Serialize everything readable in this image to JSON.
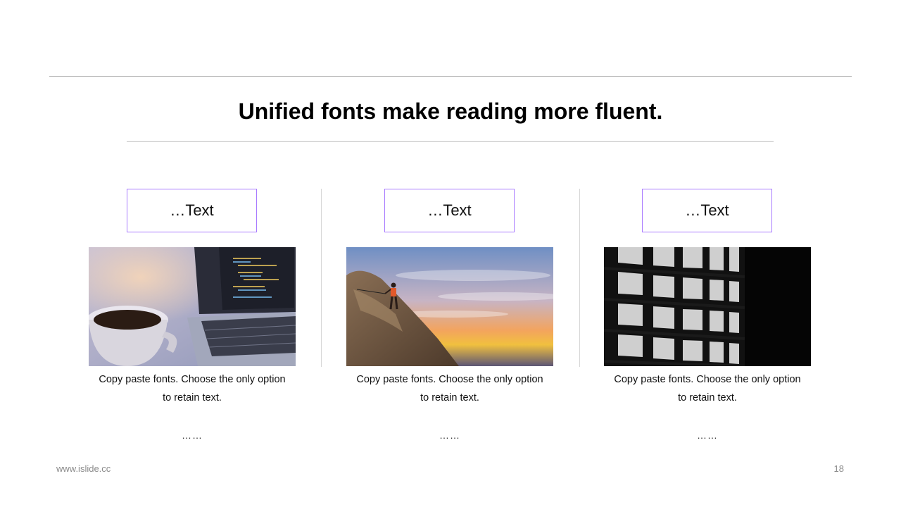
{
  "title": "Unified fonts make reading more fluent.",
  "columns": [
    {
      "label": "…Text",
      "image": "laptop-and-coffee-photo",
      "desc_line1": "Copy paste fonts. Choose the only option",
      "desc_line2": "to retain text.",
      "dots": "……"
    },
    {
      "label": "…Text",
      "image": "climber-on-rock-at-sunset-photo",
      "desc_line1": "Copy paste fonts. Choose the only option",
      "desc_line2": "to retain text.",
      "dots": "……"
    },
    {
      "label": "…Text",
      "image": "black-and-white-building-photo",
      "desc_line1": "Copy paste fonts. Choose the only option",
      "desc_line2": "to retain text.",
      "dots": "……"
    }
  ],
  "footer": {
    "website": "www.islide.cc",
    "page_number": "18"
  },
  "colors": {
    "accent_border": "#a97bff",
    "divider": "#bdbdbd"
  }
}
